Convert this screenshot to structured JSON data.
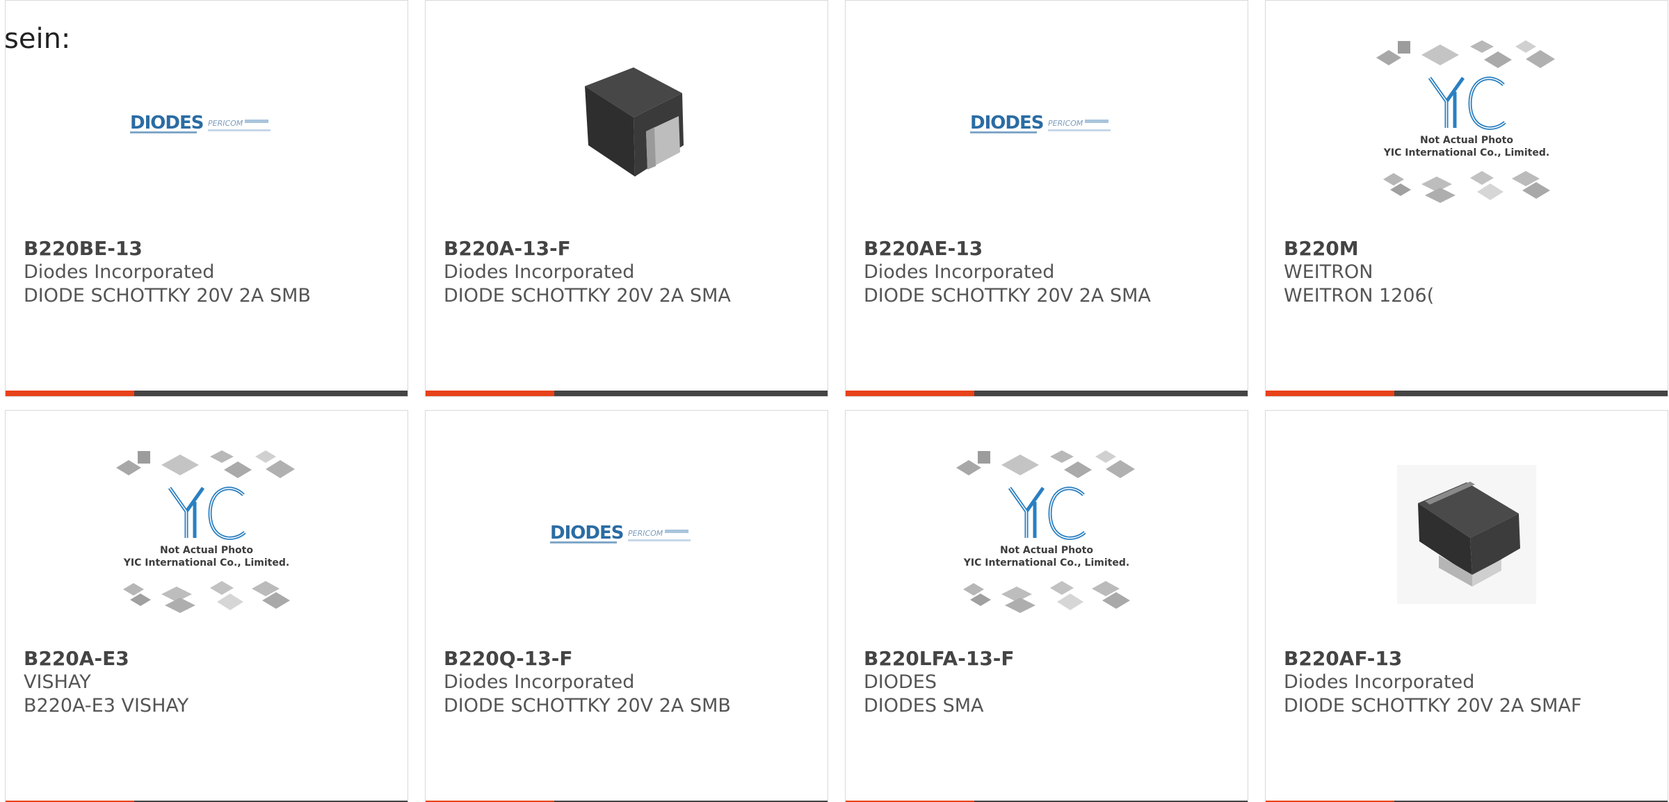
{
  "heading": "sein:",
  "colors": {
    "accent": "#e8421a",
    "bar": "#444444",
    "diodes_blue": "#2b6ca3",
    "yic_blue": "#2a7fc1"
  },
  "card_bar_accent_fraction": 0.32,
  "products": [
    {
      "part": "B220BE-13",
      "maker": "Diodes Incorporated",
      "desc": "DIODE SCHOTTKY 20V 2A SMB",
      "image": "diodes-logo",
      "logo_text": "DIODES",
      "logo_sub": "PERICOM"
    },
    {
      "part": "B220A-13-F",
      "maker": "Diodes Incorporated",
      "desc": "DIODE SCHOTTKY 20V 2A SMA",
      "image": "sma-package"
    },
    {
      "part": "B220AE-13",
      "maker": "Diodes Incorporated",
      "desc": "DIODE SCHOTTKY 20V 2A SMA",
      "image": "diodes-logo",
      "logo_text": "DIODES",
      "logo_sub": "PERICOM"
    },
    {
      "part": "B220M",
      "maker": "WEITRON",
      "desc": "WEITRON 1206(",
      "image": "yic-placeholder",
      "yic_line1": "Not Actual Photo",
      "yic_line2": "YIC International Co., Limited."
    },
    {
      "part": "B220A-E3",
      "maker": "VISHAY",
      "desc": "B220A-E3 VISHAY",
      "image": "yic-placeholder",
      "yic_line1": "Not Actual Photo",
      "yic_line2": "YIC International Co., Limited."
    },
    {
      "part": "B220Q-13-F",
      "maker": "Diodes Incorporated",
      "desc": "DIODE SCHOTTKY 20V 2A SMB",
      "image": "diodes-logo",
      "logo_text": "DIODES",
      "logo_sub": "PERICOM"
    },
    {
      "part": "B220LFA-13-F",
      "maker": "DIODES",
      "desc": "DIODES SMA",
      "image": "yic-placeholder",
      "yic_line1": "Not Actual Photo",
      "yic_line2": "YIC International Co., Limited."
    },
    {
      "part": "B220AF-13",
      "maker": "Diodes Incorporated",
      "desc": "DIODE SCHOTTKY 20V 2A SMAF",
      "image": "smaf-package"
    }
  ]
}
